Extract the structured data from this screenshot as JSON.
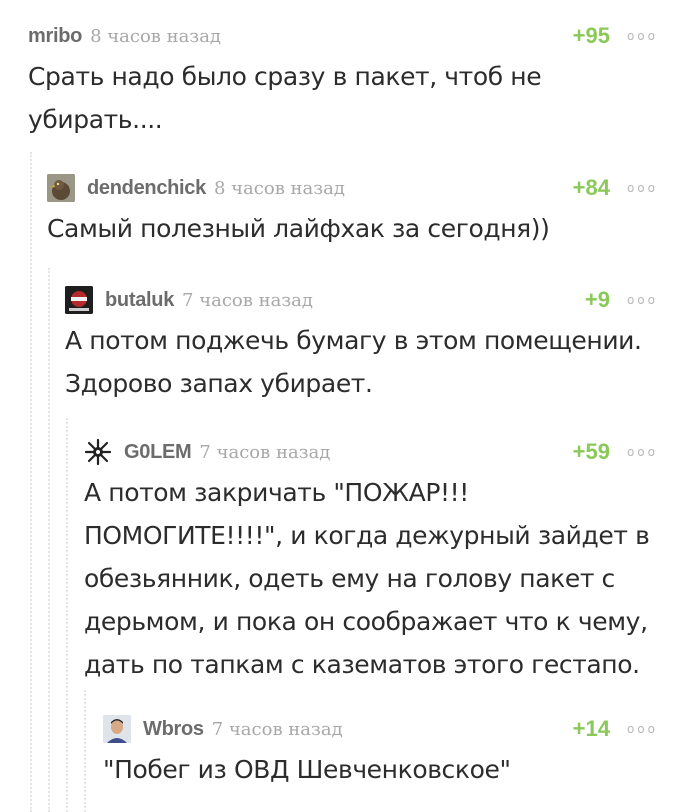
{
  "comments": [
    {
      "user": "mribo",
      "time": "8 часов назад",
      "rating": "+95",
      "more": "ooo",
      "text": "Срать надо было сразу в пакет, чтоб не убирать...."
    },
    {
      "user": "dendenchick",
      "time": "8 часов назад",
      "rating": "+84",
      "more": "ooo",
      "text": "Самый полезный лайфхак за сегодня))"
    },
    {
      "user": "butaluk",
      "time": "7 часов назад",
      "rating": "+9",
      "more": "ooo",
      "text": "А потом поджечь бумагу в этом помещении. Здорово запах убирает."
    },
    {
      "user": "G0LEM",
      "time": "7 часов назад",
      "rating": "+59",
      "more": "ooo",
      "text": "А потом закричать \"ПОЖАР!!! ПОМОГИТЕ!!!!\", и когда дежурный зайдет в обезьянник, одеть ему на голову пакет с дерьмом, и пока он соображает что к чему, дать по тапкам с казематов этого гестапо."
    },
    {
      "user": "Wbros",
      "time": "7 часов назад",
      "rating": "+14",
      "more": "ooo",
      "text": "\"Побег из ОВД Шевченковское\""
    }
  ]
}
